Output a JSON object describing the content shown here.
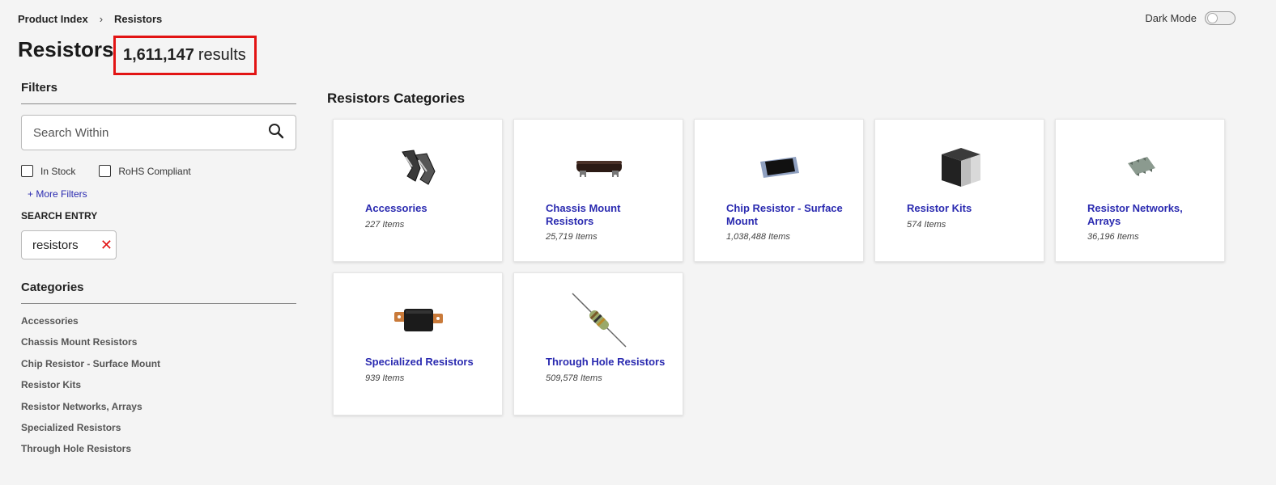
{
  "breadcrumb": {
    "root": "Product Index",
    "separator": "›",
    "current": "Resistors"
  },
  "darkmode": {
    "label": "Dark Mode"
  },
  "page": {
    "title": "Resistors",
    "results_count": "1,611,147",
    "results_label": "results"
  },
  "filters": {
    "title": "Filters",
    "search_placeholder": "Search Within",
    "search_icon": "search-icon",
    "checkboxes": [
      {
        "label": "In Stock"
      },
      {
        "label": "RoHS Compliant"
      }
    ],
    "more_filters": "+ More Filters",
    "search_entry_label": "SEARCH ENTRY",
    "search_entry_value": "resistors",
    "clear_icon": "close-icon",
    "clear_symbol": "✕"
  },
  "categories": {
    "title": "Categories",
    "items": [
      "Accessories",
      "Chassis Mount Resistors",
      "Chip Resistor - Surface Mount",
      "Resistor Kits",
      "Resistor Networks, Arrays",
      "Specialized Resistors",
      "Through Hole Resistors"
    ]
  },
  "main": {
    "title": "Resistors Categories",
    "cards": [
      {
        "name": "Accessories",
        "count": "227 Items"
      },
      {
        "name": "Chassis Mount Resistors",
        "count": "25,719 Items"
      },
      {
        "name": "Chip Resistor - Surface Mount",
        "count": "1,038,488 Items"
      },
      {
        "name": "Resistor Kits",
        "count": "574 Items"
      },
      {
        "name": "Resistor Networks, Arrays",
        "count": "36,196 Items"
      },
      {
        "name": "Specialized Resistors",
        "count": "939 Items"
      },
      {
        "name": "Through Hole Resistors",
        "count": "509,578 Items"
      }
    ]
  },
  "colors": {
    "link": "#2a2ab0",
    "highlight": "#e21414",
    "background": "#f4f4f4"
  }
}
